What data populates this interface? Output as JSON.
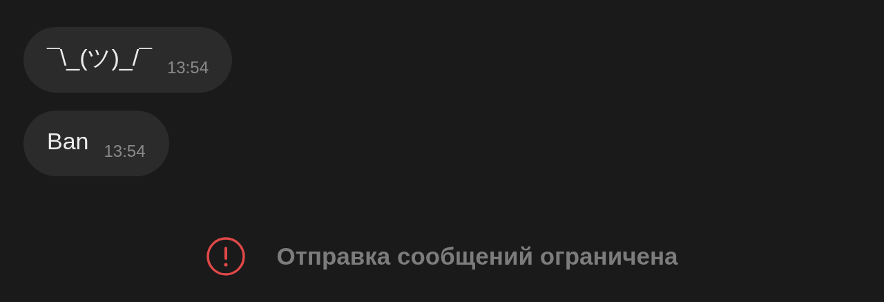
{
  "messages": [
    {
      "text": "¯\\_(ツ)_/¯",
      "time": "13:54"
    },
    {
      "text": "Ban",
      "time": "13:54"
    }
  ],
  "notice": {
    "kind": "error",
    "text": "Отправка сообщений ограничена"
  }
}
